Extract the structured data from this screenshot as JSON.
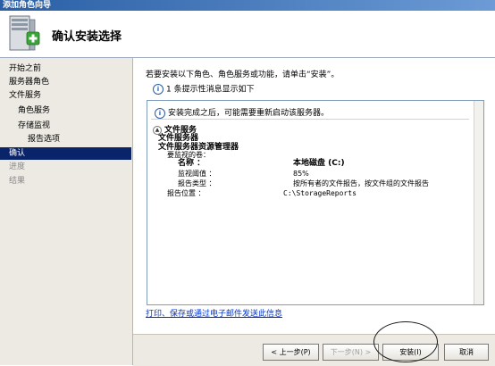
{
  "window": {
    "title": "添加角色向导"
  },
  "header": {
    "title": "确认安装选择"
  },
  "sidebar": {
    "items": [
      {
        "label": "开始之前",
        "state": "normal"
      },
      {
        "label": "服务器角色",
        "state": "normal"
      },
      {
        "label": "文件服务",
        "state": "normal"
      },
      {
        "label": "角色服务",
        "state": "normal"
      },
      {
        "label": "存储监视",
        "state": "normal"
      },
      {
        "label": "报告选项",
        "state": "normal"
      },
      {
        "label": "确认",
        "state": "selected"
      },
      {
        "label": "进度",
        "state": "inactive"
      },
      {
        "label": "结果",
        "state": "inactive"
      }
    ]
  },
  "main": {
    "intro": "若要安装以下角色、角色服务或功能，请单击“安装”。",
    "info_message": "1 条提示性消息显示如下",
    "panel": {
      "note": "安装完成之后，可能需要重新启动该服务器。",
      "section_title": "文件服务",
      "service_1": "文件服务器",
      "service_2": "文件服务器资源管理器",
      "monitored_volumes_label": "要监视的卷：",
      "name_label": "名称 ：",
      "name_value": "本地磁盘 (C:)",
      "threshold_label": "监视阈值 ：",
      "threshold_value": "85%",
      "report_type_label": "报告类型 ：",
      "report_type_value": "按所有者的文件报告，按文件组的文件报告",
      "report_location_label": "报告位置 ：",
      "report_location_value": "C:\\StorageReports"
    },
    "link": "打印、保存或通过电子邮件发送此信息"
  },
  "footer": {
    "back": "< 上一步(P)",
    "next": "下一步(N) >",
    "install": "安装(I)",
    "cancel": "取消"
  },
  "colors": {
    "title_bar": "#2a5fa5",
    "sidebar_bg": "#eceae3",
    "selected_bg": "#0a246a",
    "link": "#0033cc"
  }
}
